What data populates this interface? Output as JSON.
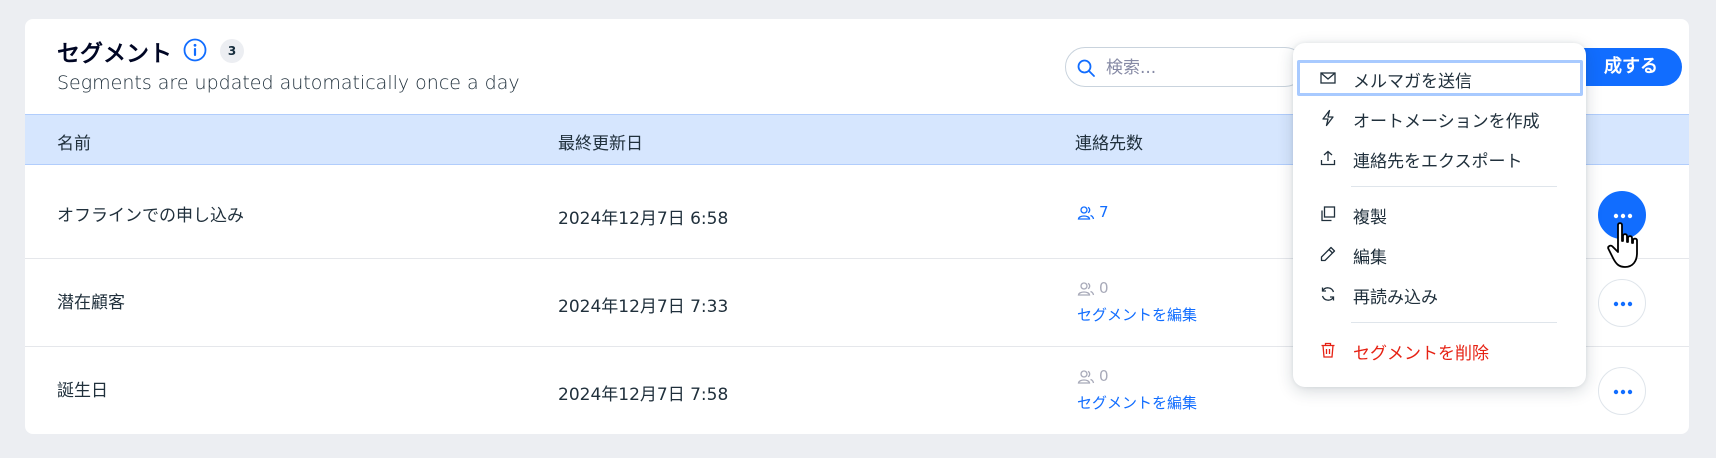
{
  "header": {
    "title": "セグメント",
    "count": "3",
    "subtitle": "Segments are updated automatically once a day"
  },
  "search": {
    "placeholder": "検索..."
  },
  "create_button_label": "成する",
  "table": {
    "columns": [
      "名前",
      "最終更新日",
      "連絡先数"
    ],
    "rows": [
      {
        "name": "オフラインでの申し込み",
        "date": "2024年12月7日 6:58",
        "contacts": "7",
        "edit": ""
      },
      {
        "name": "潜在顧客",
        "date": "2024年12月7日 7:33",
        "contacts": "0",
        "edit": "セグメントを編集"
      },
      {
        "name": "誕生日",
        "date": "2024年12月7日 7:58",
        "contacts": "0",
        "edit": "セグメントを編集"
      }
    ]
  },
  "menu": {
    "items": [
      {
        "label": "メルマガを送信",
        "icon": "mail-icon"
      },
      {
        "label": "オートメーションを作成",
        "icon": "lightning-icon"
      },
      {
        "label": "連絡先をエクスポート",
        "icon": "upload-icon"
      },
      {
        "label": "複製",
        "icon": "duplicate-icon"
      },
      {
        "label": "編集",
        "icon": "pencil-icon"
      },
      {
        "label": "再読み込み",
        "icon": "refresh-icon"
      },
      {
        "label": "セグメントを削除",
        "icon": "trash-icon"
      }
    ]
  },
  "colors": {
    "accent": "#116dff",
    "header_bg": "#d6e6fe",
    "danger": "#e62214"
  }
}
